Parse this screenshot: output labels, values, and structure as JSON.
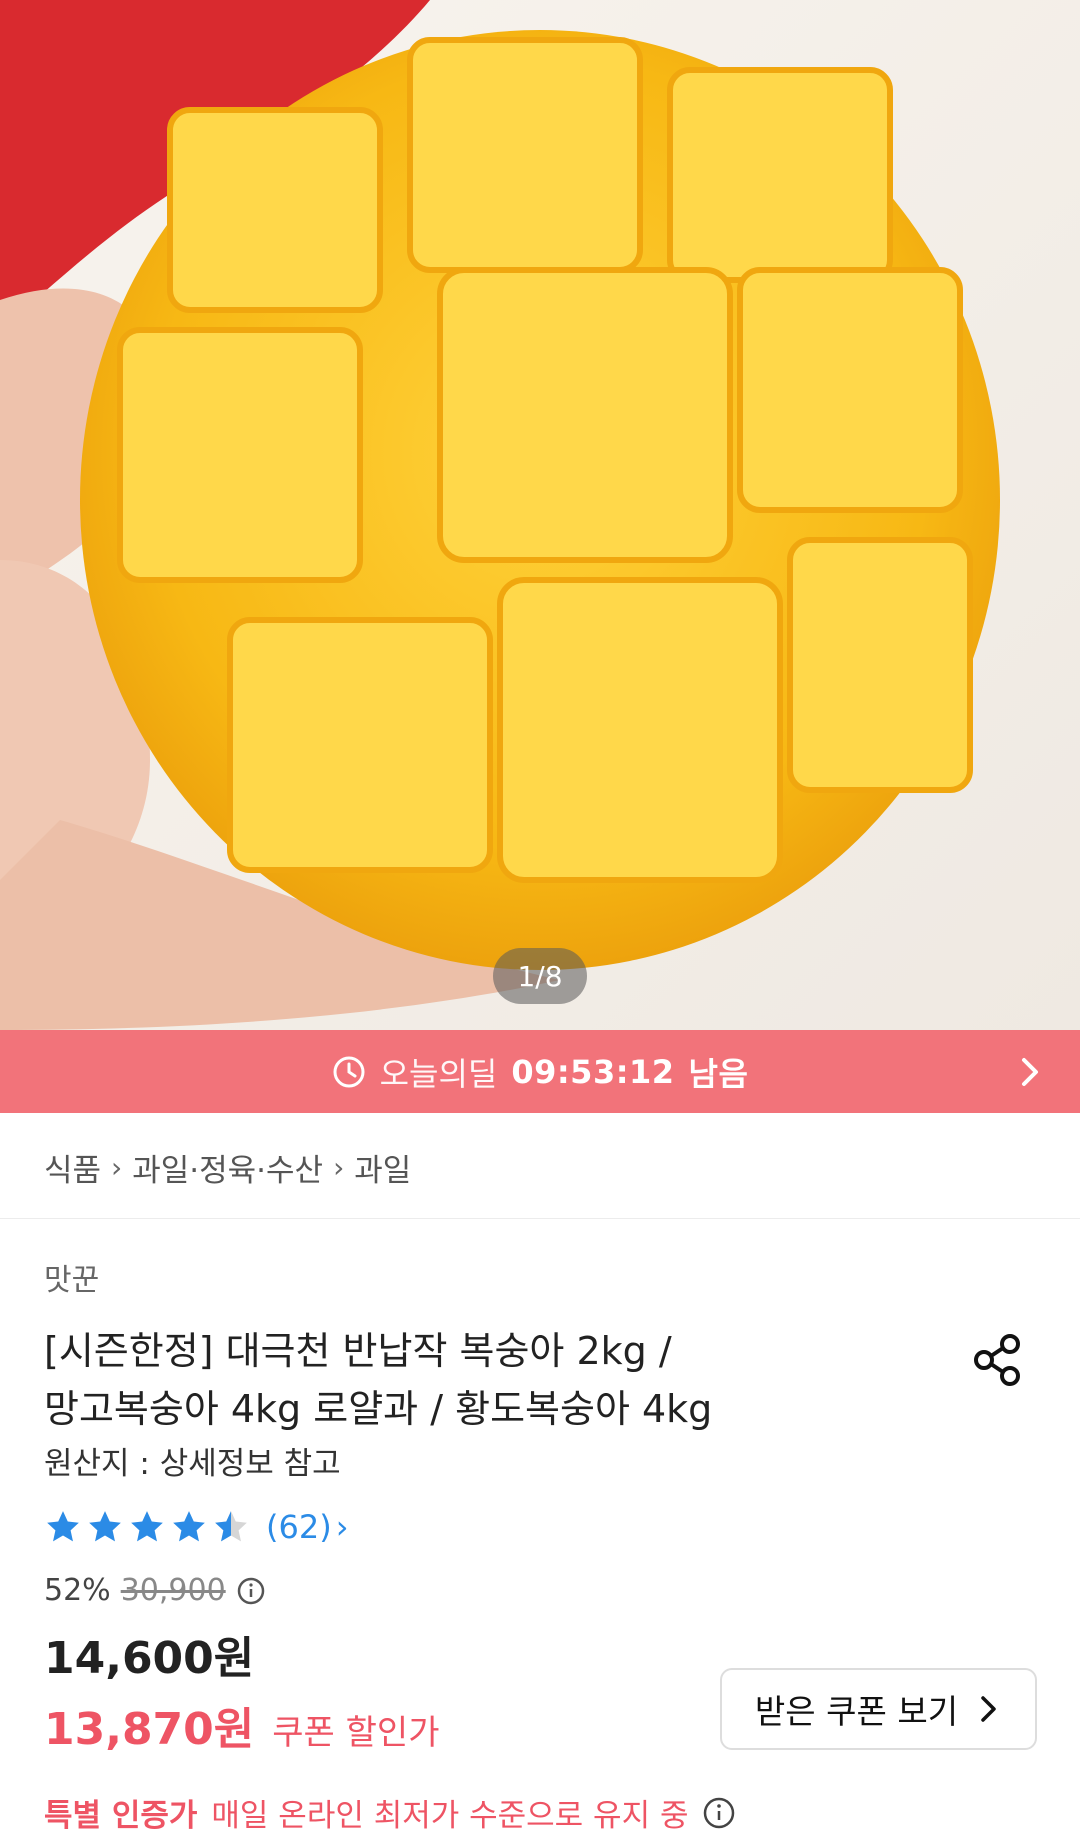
{
  "hero": {
    "image_counter": "1/8"
  },
  "deal": {
    "label": "오늘의딜",
    "time": "09:53:12",
    "suffix": "남음"
  },
  "breadcrumb": [
    "식품",
    "과일·정육·수산",
    "과일"
  ],
  "seller": "맛꾼",
  "product": {
    "title_line1": "[시즌한정] 대극천 반납작 복숭아 2kg /",
    "title_line2": "망고복숭아 4kg 로얄과 / 황도복숭아 4kg",
    "origin": "원산지 : 상세정보 참고"
  },
  "rating": {
    "stars": 4.5,
    "review_count": "(62)"
  },
  "pricing": {
    "discount": "52%",
    "original_price": "30,900",
    "price": "14,600원",
    "coupon_price": "13,870원",
    "coupon_label": "쿠폰 할인가",
    "coupon_button": "받은 쿠폰 보기"
  },
  "special": {
    "tag": "특별 인증가",
    "text": "매일 온라인 최저가 수준으로 유지 중"
  },
  "colors": {
    "accent": "#f2737a",
    "price_red": "#ee5464",
    "link_blue": "#2b8be6",
    "star_blue": "#2b8be6"
  }
}
